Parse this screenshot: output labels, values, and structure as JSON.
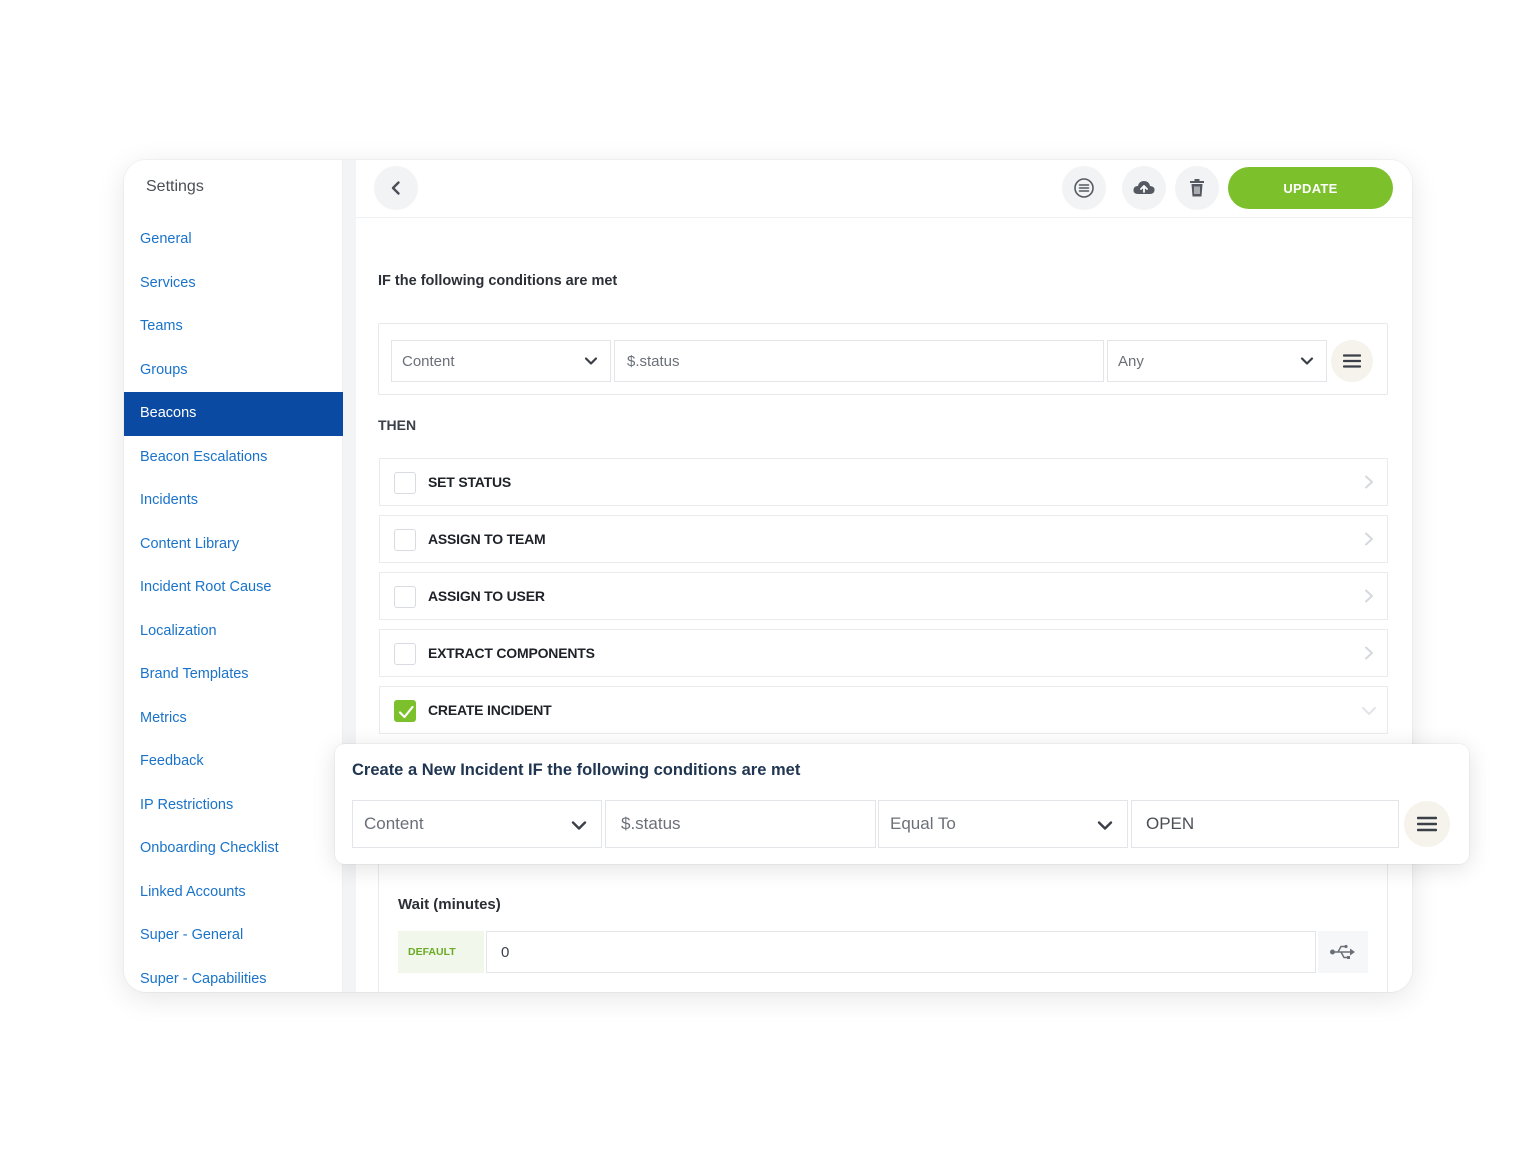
{
  "sidebar": {
    "title": "Settings",
    "items": [
      {
        "label": "General"
      },
      {
        "label": "Services"
      },
      {
        "label": "Teams"
      },
      {
        "label": "Groups"
      },
      {
        "label": "Beacons",
        "active": true
      },
      {
        "label": "Beacon Escalations"
      },
      {
        "label": "Incidents"
      },
      {
        "label": "Content Library"
      },
      {
        "label": "Incident Root Cause"
      },
      {
        "label": "Localization"
      },
      {
        "label": "Brand Templates"
      },
      {
        "label": "Metrics"
      },
      {
        "label": "Feedback"
      },
      {
        "label": "IP Restrictions"
      },
      {
        "label": "Onboarding Checklist"
      },
      {
        "label": "Linked Accounts"
      },
      {
        "label": "Super - General"
      },
      {
        "label": "Super - Capabilities"
      }
    ]
  },
  "toolbar": {
    "update_label": "UPDATE",
    "icons": [
      "back-chevron-icon",
      "list-icon",
      "cloud-upload-icon",
      "trash-icon",
      "cloud-download-icon",
      "close-icon"
    ]
  },
  "conditions": {
    "title": "IF the following conditions are met",
    "source": "Content",
    "path": "$.status",
    "operator": "Any"
  },
  "then": {
    "label": "THEN",
    "actions": [
      {
        "label": "SET STATUS",
        "checked": false
      },
      {
        "label": "ASSIGN TO TEAM",
        "checked": false
      },
      {
        "label": "ASSIGN TO USER",
        "checked": false
      },
      {
        "label": "EXTRACT COMPONENTS",
        "checked": false
      },
      {
        "label": "CREATE INCIDENT",
        "checked": true
      }
    ]
  },
  "wait": {
    "label": "Wait (minutes)",
    "badge": "DEFAULT",
    "value": "0"
  },
  "incident_card": {
    "title": "Create a New Incident IF the following conditions are met",
    "source": "Content",
    "path": "$.status",
    "operator": "Equal To",
    "value": "OPEN"
  },
  "colors": {
    "accent_green": "#7cc02c",
    "nav_active": "#0b4aa3",
    "nav_link": "#1a73c9"
  }
}
